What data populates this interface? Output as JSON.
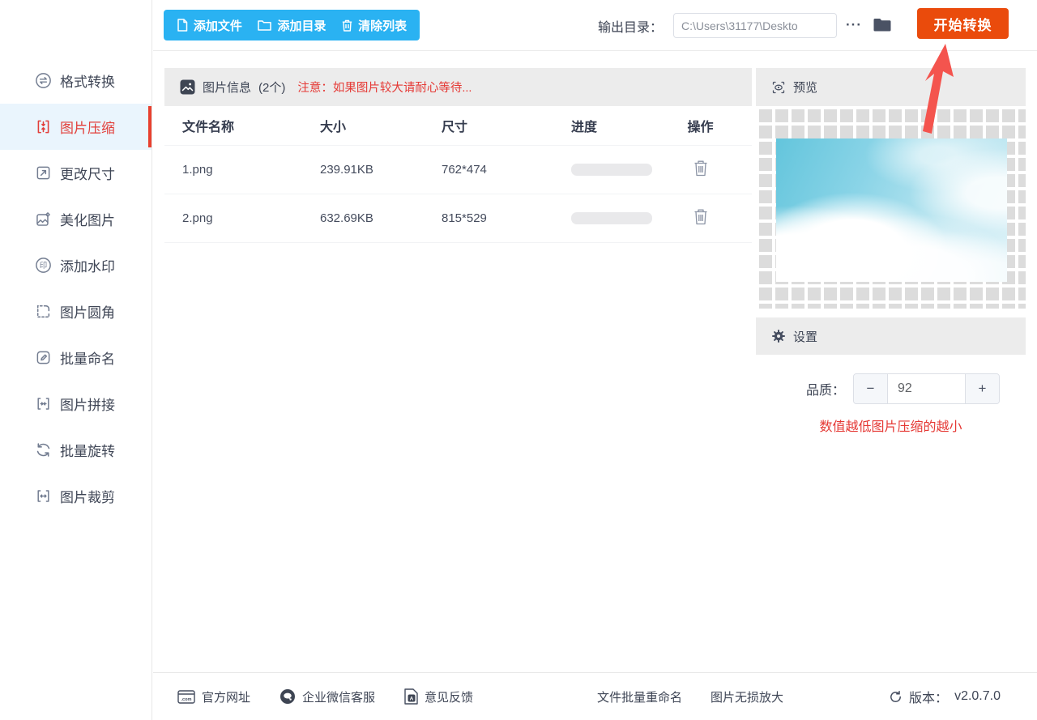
{
  "colors": {
    "blue": "#2ab2f2",
    "orange": "#ea4b0c",
    "red": "#e23f3a",
    "red-bright": "#e53935",
    "arrow": "#f4544e"
  },
  "sidebar": {
    "items": [
      {
        "label": "格式转换",
        "active": false
      },
      {
        "label": "图片压缩",
        "active": true
      },
      {
        "label": "更改尺寸",
        "active": false
      },
      {
        "label": "美化图片",
        "active": false
      },
      {
        "label": "添加水印",
        "active": false
      },
      {
        "label": "图片圆角",
        "active": false
      },
      {
        "label": "批量命名",
        "active": false
      },
      {
        "label": "图片拼接",
        "active": false
      },
      {
        "label": "批量旋转",
        "active": false
      },
      {
        "label": "图片裁剪",
        "active": false
      }
    ]
  },
  "toolbar": {
    "add_file": "添加文件",
    "add_dir": "添加目录",
    "clear_list": "清除列表",
    "output_label": "输出目录：",
    "output_path": "C:\\Users\\31177\\Deskto",
    "more": "···",
    "start": "开始转换"
  },
  "table": {
    "title": "图片信息",
    "count": "(2个)",
    "notice": "注意：如果图片较大请耐心等待...",
    "columns": [
      "文件名称",
      "大小",
      "尺寸",
      "进度",
      "操作"
    ],
    "rows": [
      {
        "name": "1.png",
        "size": "239.91KB",
        "dims": "762*474"
      },
      {
        "name": "2.png",
        "size": "632.69KB",
        "dims": "815*529"
      }
    ]
  },
  "preview": {
    "title": "预览"
  },
  "settings": {
    "title": "设置",
    "quality_label": "品质：",
    "quality_value": "92",
    "minus": "−",
    "plus": "+",
    "hint": "数值越低图片压缩的越小"
  },
  "footer": {
    "site": "官方网址",
    "wechat_service": "企业微信客服",
    "feedback": "意见反馈",
    "batch_rename": "文件批量重命名",
    "lossless_upscale": "图片无损放大",
    "version_label": "版本：",
    "version": "v2.0.7.0"
  }
}
